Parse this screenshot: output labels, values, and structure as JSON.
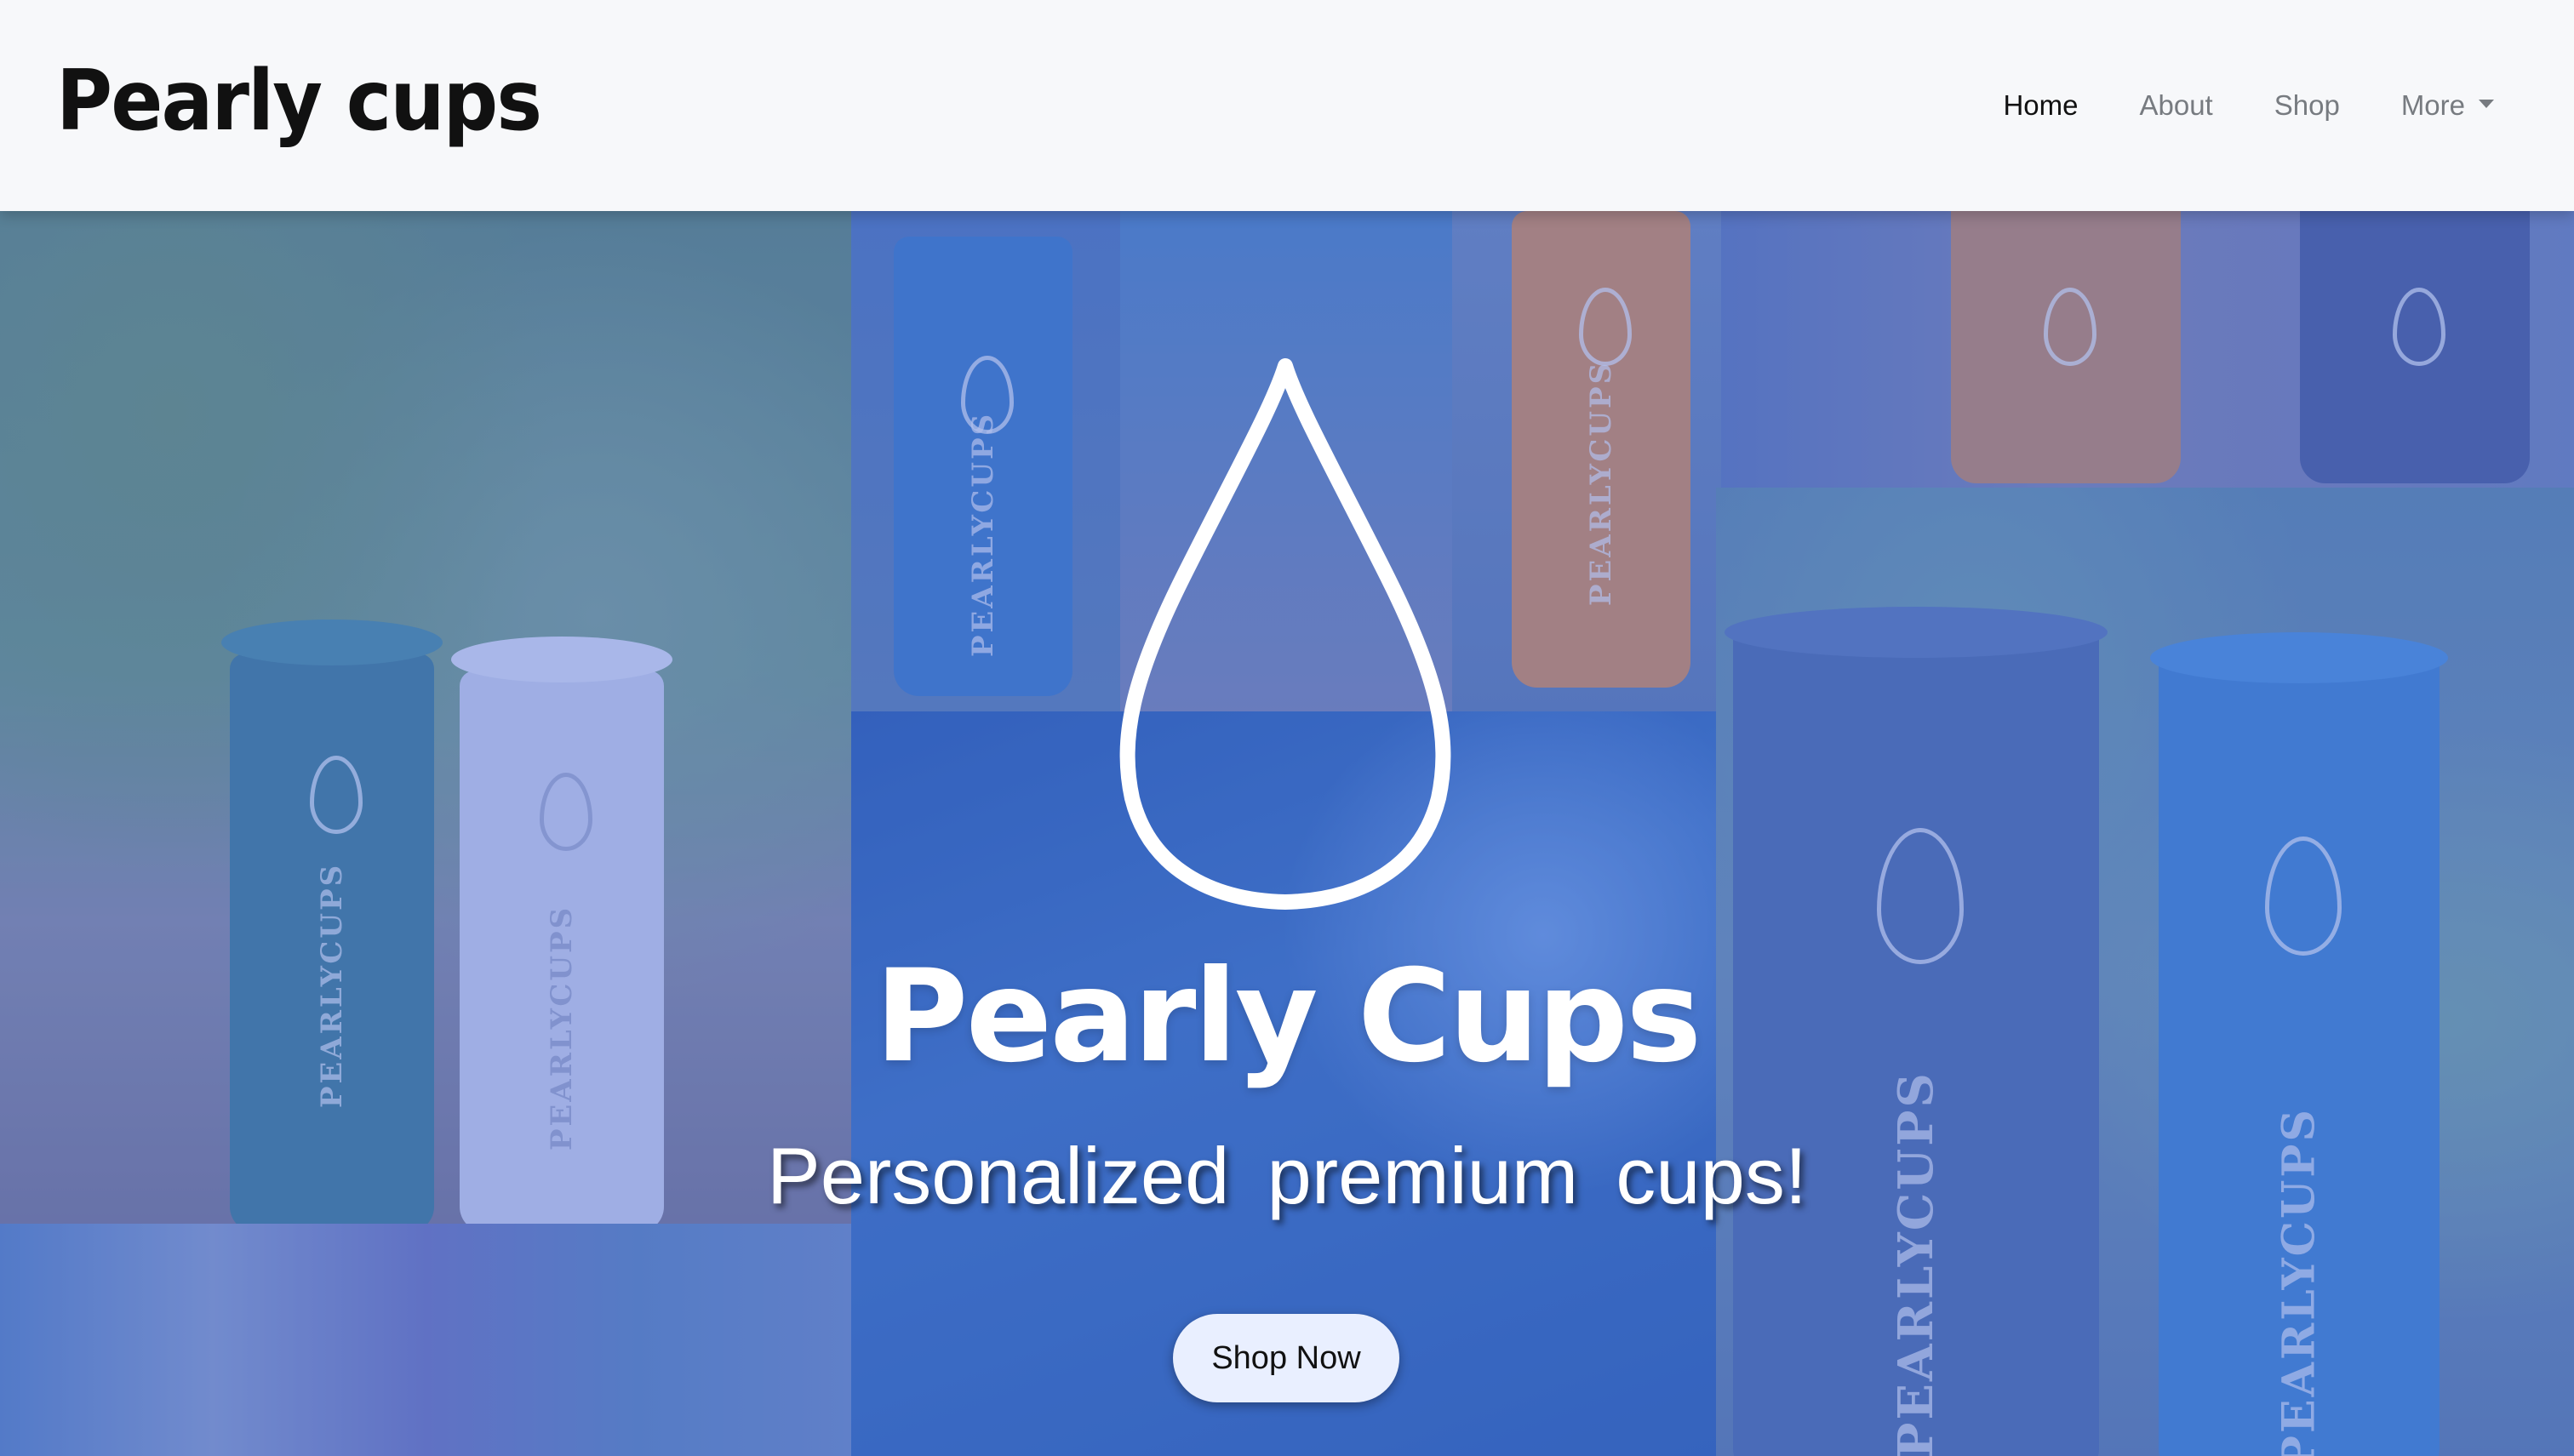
{
  "navbar": {
    "brand": "Pearly cups",
    "items": [
      {
        "label": "Home",
        "active": true
      },
      {
        "label": "About",
        "active": false
      },
      {
        "label": "Shop",
        "active": false
      },
      {
        "label": "More",
        "active": false,
        "has_dropdown": true
      }
    ]
  },
  "hero": {
    "title": "Pearly Cups",
    "subtitle": "Personalized premium cups!",
    "cta_label": "Shop Now",
    "overlay_color": "#4664c8",
    "cup_text": "PEARLYCUPS"
  },
  "colors": {
    "navbar_bg": "#f7f8fa",
    "button_bg": "#e9efff",
    "nav_active": "#111111",
    "nav_inactive": "#777b80"
  }
}
